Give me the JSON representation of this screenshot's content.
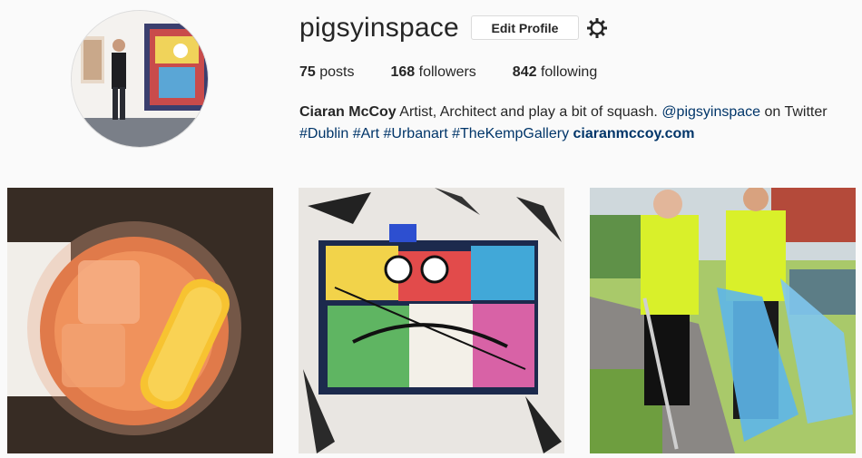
{
  "profile": {
    "username": "pigsyinspace",
    "edit_label": "Edit Profile",
    "posts_count": "75",
    "posts_label": "posts",
    "followers_count": "168",
    "followers_label": "followers",
    "following_count": "842",
    "following_label": "following",
    "full_name": "Ciaran McCoy",
    "bio_text": "Artist, Architect and play a bit of squash.",
    "mention": "@pigsyinspace",
    "mention_suffix": "on Twitter",
    "hashtags": [
      "#Dublin",
      "#Art",
      "#Urbanart",
      "#TheKempGallery"
    ],
    "website": "ciaranmccoy.com"
  },
  "posts": [
    {
      "subject": "cocktail-with-orange-peel"
    },
    {
      "subject": "graffiti-painting"
    },
    {
      "subject": "canal-litter-pick"
    }
  ],
  "colors": {
    "link": "#003569",
    "text": "#262626",
    "background": "#fafafa"
  }
}
